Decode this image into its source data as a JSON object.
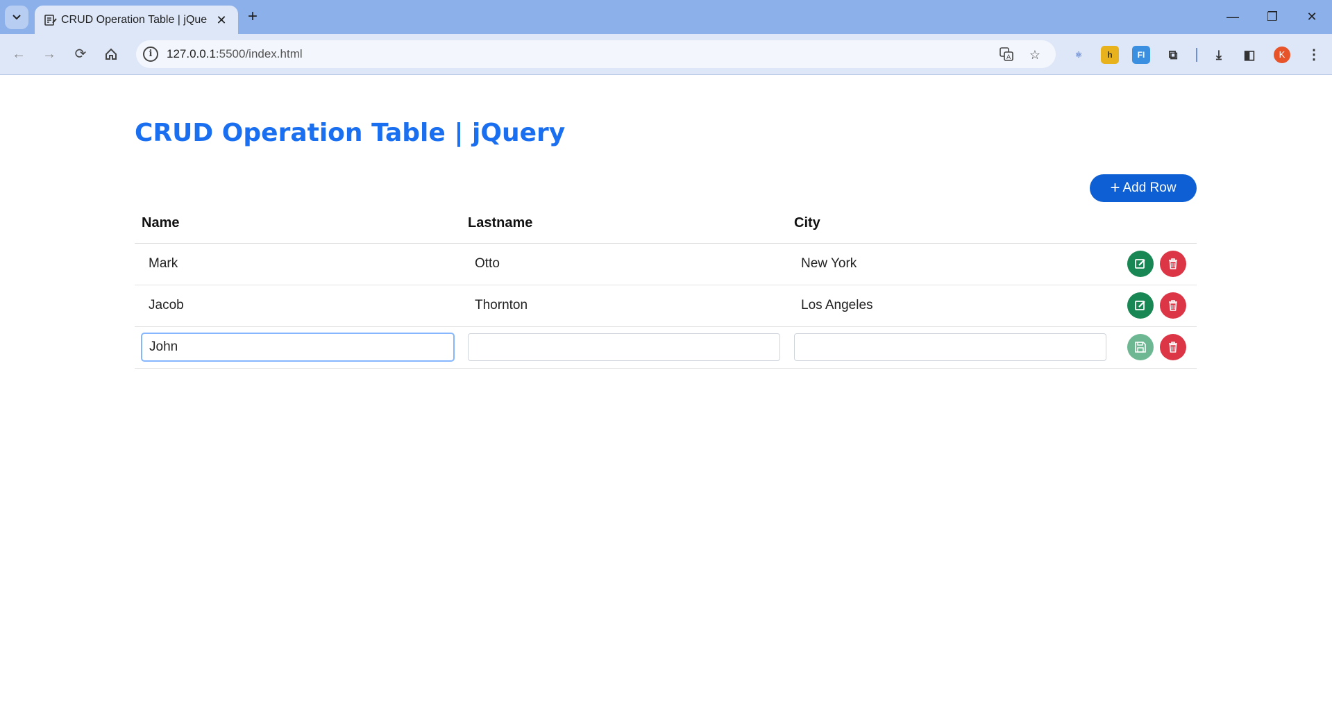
{
  "browser": {
    "tab_title": "CRUD Operation Table | jQuery",
    "url_host": "127.0.0.1",
    "url_rest": ":5500/index.html",
    "avatar_letter": "K"
  },
  "page": {
    "title": "CRUD Operation Table | jQuery",
    "add_button_label": "Add Row"
  },
  "table": {
    "headers": [
      "Name",
      "Lastname",
      "City"
    ],
    "rows": [
      {
        "name": "Mark",
        "lastname": "Otto",
        "city": "New York"
      },
      {
        "name": "Jacob",
        "lastname": "Thornton",
        "city": "Los Angeles"
      }
    ],
    "edit_row": {
      "name": "John",
      "lastname": "",
      "city": ""
    }
  },
  "colors": {
    "title": "#1a6ff0",
    "add_button": "#0d5fd3",
    "edit": "#198754",
    "delete": "#dc3545"
  }
}
